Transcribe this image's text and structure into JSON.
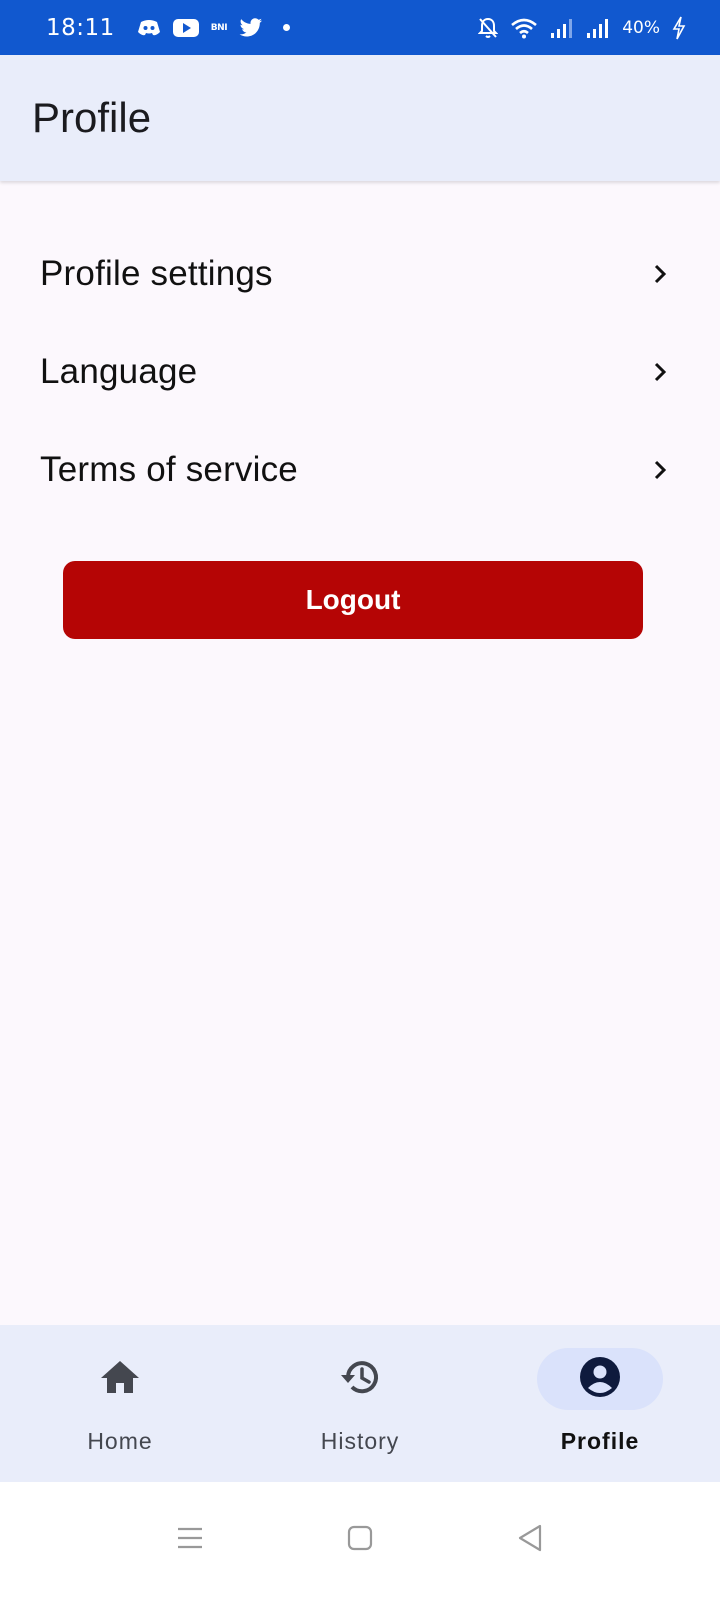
{
  "status_bar": {
    "time": "18:11",
    "notification_text": "BNI",
    "battery": "40%",
    "icons": [
      "discord-icon",
      "youtube-icon",
      "bni-icon",
      "twitter-icon",
      "dot-icon",
      "mute-bell-icon",
      "wifi-icon",
      "signal-icon",
      "signal-icon",
      "charging-icon"
    ]
  },
  "app_bar": {
    "title": "Profile"
  },
  "menu": {
    "items": [
      {
        "label": "Profile settings",
        "icon": "chevron-right-icon"
      },
      {
        "label": "Language",
        "icon": "chevron-right-icon"
      },
      {
        "label": "Terms of service",
        "icon": "chevron-right-icon"
      }
    ]
  },
  "logout": {
    "label": "Logout",
    "color": "#b50505"
  },
  "bottom_nav": {
    "items": [
      {
        "label": "Home",
        "icon": "home-icon",
        "active": false
      },
      {
        "label": "History",
        "icon": "history-icon",
        "active": false
      },
      {
        "label": "Profile",
        "icon": "account-circle-icon",
        "active": true
      }
    ]
  },
  "system_nav": [
    "menu-icon",
    "home-square-icon",
    "back-triangle-icon"
  ],
  "colors": {
    "status_bar": "#1158cf",
    "app_bar": "#e9edfa",
    "background": "#fcf8fd",
    "active_pill": "#dae2fb"
  }
}
